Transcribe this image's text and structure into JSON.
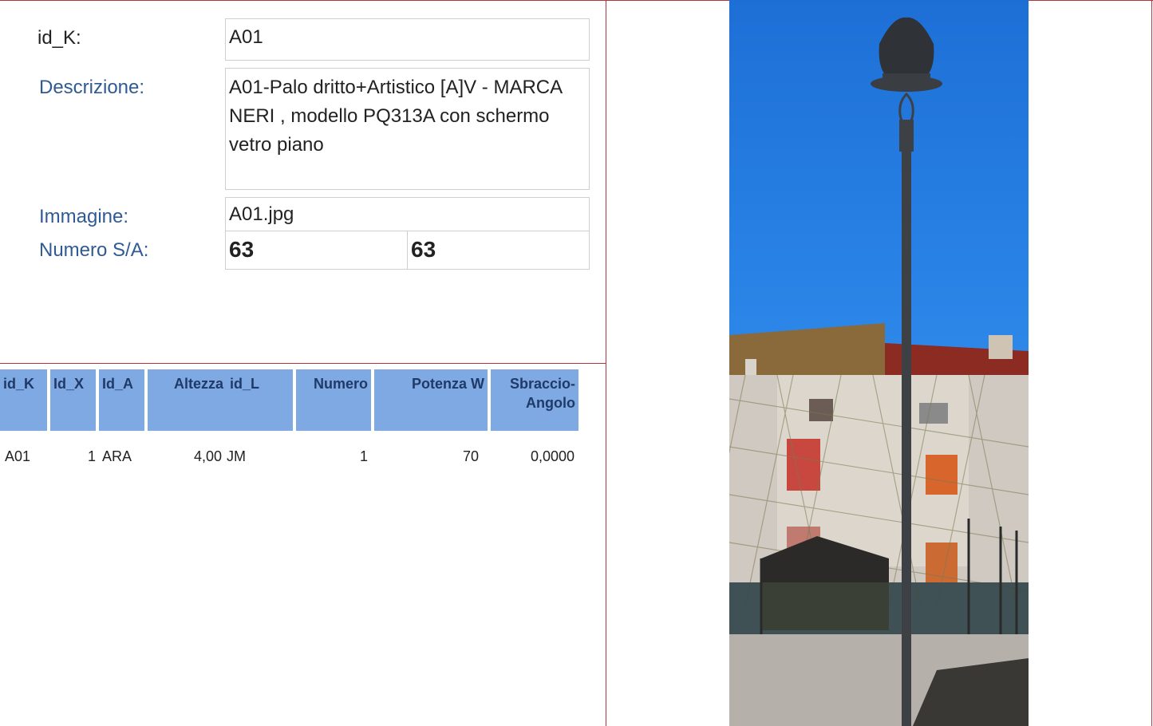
{
  "form": {
    "id_k_label": "id_K:",
    "id_k_value": "A01",
    "descrizione_label": "Descrizione:",
    "descrizione_value": "A01-Palo dritto+Artistico [A]V - MARCA  NERI , modello PQ313A con schermo vetro piano",
    "immagine_label": "Immagine:",
    "immagine_value": "A01.jpg",
    "numero_sa_label": "Numero S/A:",
    "numero_s_value": "63",
    "numero_a_value": "63"
  },
  "table": {
    "columns": [
      "id_K",
      "Id_X",
      "Id_A",
      "Altezza",
      "id_L",
      "Numero",
      "Potenza W",
      "Sbraccio-\nAngolo"
    ],
    "rows": [
      [
        "A01",
        "1",
        "ARA",
        "4,00",
        "JM",
        "1",
        "70",
        "0,0000"
      ]
    ]
  },
  "colors": {
    "border_red": "#b3363c",
    "label_blue": "#2e5b95",
    "header_blue": "#7fa9e3",
    "header_text": "#1f3a68"
  },
  "image": {
    "name": "street-lamp-photo"
  }
}
